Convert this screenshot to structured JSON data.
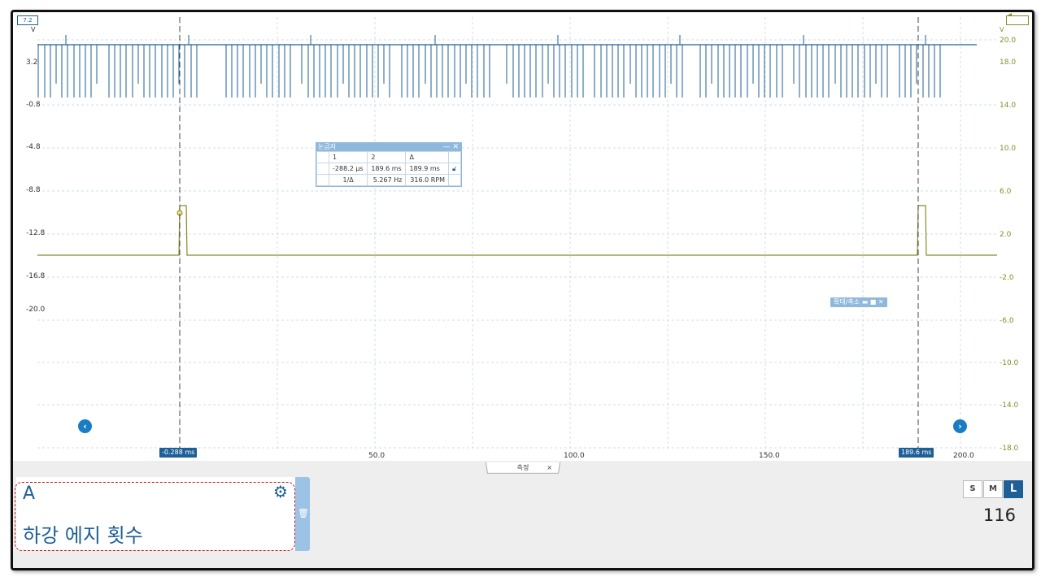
{
  "channels": {
    "a": {
      "tag": "7.2",
      "unit": "V",
      "color": "#1d5f96",
      "axis_ticks": [
        "3.2",
        "-0.8",
        "-4.8",
        "-8.8",
        "-12.8",
        "-16.8",
        "-20.0"
      ]
    },
    "b": {
      "unit": "V",
      "color": "#8a8a2a",
      "axis_ticks": [
        "20.0",
        "18.0",
        "14.0",
        "10.0",
        "6.0",
        "2.0",
        "-2.0",
        "-6.0",
        "-10.0",
        "-14.0",
        "-18.0"
      ]
    }
  },
  "time_axis": {
    "ticks": [
      "50.0",
      "100.0",
      "150.0",
      "200.0"
    ]
  },
  "cursors": {
    "left_label": "-0.288 ms",
    "right_label": "189.6 ms"
  },
  "cursor_table": {
    "title": "눈금자",
    "header": [
      "1",
      "2",
      "Δ"
    ],
    "row1": [
      "-288.2 µs",
      "189.6 ms",
      "189.9 ms"
    ],
    "row2": [
      "1/Δ",
      "5.267 Hz",
      "316.0 RPM"
    ]
  },
  "zoom_control": {
    "label": "확대/축소"
  },
  "measurements_tab": {
    "label": "측정",
    "close": "×"
  },
  "measurement": {
    "channel": "A",
    "value": "116",
    "label": "하강 에지 횟수"
  },
  "size_buttons": [
    "S",
    "M",
    "L"
  ],
  "size_selected": "L",
  "icons": {
    "nav_left": "chevron-left-icon",
    "nav_right": "chevron-right-icon",
    "gear": "gear-icon",
    "trash": "trash-icon",
    "lock": "lock-icon",
    "close": "close-icon"
  }
}
